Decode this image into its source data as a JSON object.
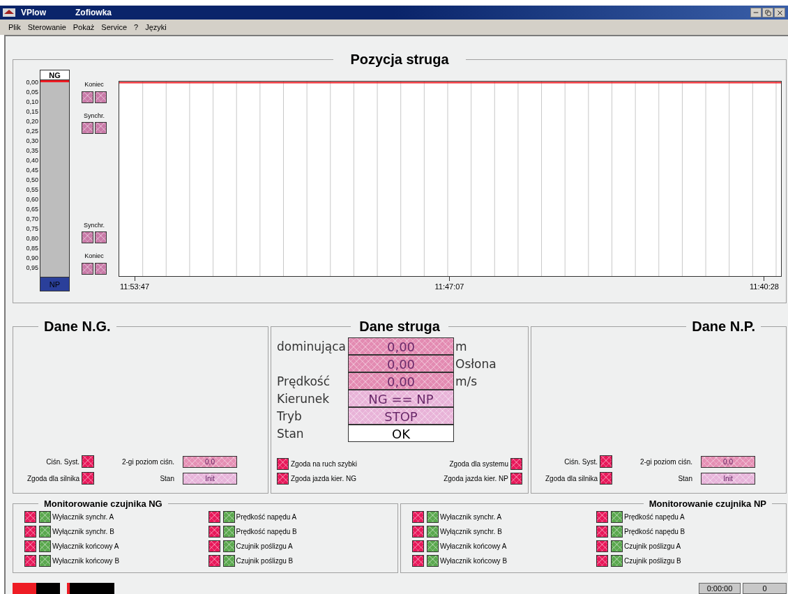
{
  "window": {
    "app": "VPlow",
    "title": "Zofiowka"
  },
  "menu": [
    "Plik",
    "Sterowanie",
    "Pokaż",
    "Service",
    "?",
    "Języki"
  ],
  "position": {
    "title": "Pozycja struga",
    "top_label": "NG",
    "bottom_label": "NP",
    "level": 0,
    "scale": [
      "0,00",
      "0,05",
      "0,10",
      "0,15",
      "0,20",
      "0,25",
      "0,30",
      "0,35",
      "0,40",
      "0,45",
      "0,50",
      "0,55",
      "0,60",
      "0,65",
      "0,70",
      "0,75",
      "0,80",
      "0,85",
      "0,90",
      "0,95"
    ],
    "upper_indicators": [
      {
        "label": "Koniec",
        "lamps": [
          {
            "color": "#c97aa8"
          },
          {
            "color": "#c97aa8"
          }
        ]
      },
      {
        "label": "Synchr.",
        "lamps": [
          {
            "color": "#c97aa8"
          },
          {
            "color": "#c97aa8"
          }
        ]
      }
    ],
    "lower_indicators": [
      {
        "label": "Synchr.",
        "lamps": [
          {
            "color": "#c97aa8"
          },
          {
            "color": "#c97aa8"
          }
        ]
      },
      {
        "label": "Koniec",
        "lamps": [
          {
            "color": "#c97aa8"
          },
          {
            "color": "#c97aa8"
          }
        ]
      }
    ],
    "time_labels": [
      "11:53:47",
      "11:47:07",
      "11:40:28"
    ]
  },
  "ng": {
    "title": "Dane N.G.",
    "lamps": [
      {
        "label": "Ciśn. Syst.",
        "color": "#e8185a"
      },
      {
        "label": "Zgoda dla silnika",
        "color": "#e8185a"
      }
    ],
    "fields": [
      {
        "label": "2-gi poziom ciśn.",
        "value": "0,0",
        "color": "#e58fb4"
      },
      {
        "label": "Stan",
        "value": "Init",
        "color": "#e7b4da"
      }
    ]
  },
  "plow": {
    "title": "Dane struga",
    "rows": [
      {
        "label": "dominująca",
        "value": "0,00",
        "unit": "m",
        "color": "#e38bb2"
      },
      {
        "value": "0,00",
        "unit": "Osłona",
        "color": "#e38bb2"
      },
      {
        "label": "Prędkość",
        "value": "0,00",
        "unit": "m/s",
        "color": "#e38bb2"
      },
      {
        "label": "Kierunek",
        "value": "NG == NP",
        "color": "#e8b3d8"
      },
      {
        "label": "Tryb",
        "value": "STOP",
        "color": "#e8b3d8"
      },
      {
        "label": "Stan",
        "value": "OK",
        "color": "#ffffff"
      }
    ],
    "lamps_left": [
      {
        "label": "Zgoda na ruch szybki",
        "color": "#e8185a"
      },
      {
        "label": "Zgoda jazda kier. NG",
        "color": "#e8185a"
      }
    ],
    "lamps_right": [
      {
        "label": "Zgoda dla systemu",
        "color": "#e8185a"
      },
      {
        "label": "Zgoda jazda kier. NP",
        "color": "#e8185a"
      }
    ]
  },
  "np": {
    "title": "Dane N.P.",
    "lamps": [
      {
        "label": "Ciśn. Syst.",
        "color": "#e8185a"
      },
      {
        "label": "Zgoda dla silnika",
        "color": "#e8185a"
      }
    ],
    "fields": [
      {
        "label": "2-gi poziom ciśn.",
        "value": "0,0",
        "color": "#e58fb4"
      },
      {
        "label": "Stan",
        "value": "Init",
        "color": "#e7b4da"
      }
    ]
  },
  "monitors": [
    {
      "title": "Monitorowanie czujnika NG",
      "columns": [
        [
          {
            "label": "Wyłacznik synchr. A",
            "lamps": [
              {
                "color": "#e8185a"
              },
              {
                "color": "#5aa84e"
              }
            ]
          },
          {
            "label": "Wyłącznik synchr. B",
            "lamps": [
              {
                "color": "#e8185a"
              },
              {
                "color": "#5aa84e"
              }
            ]
          },
          {
            "label": "Wyłacznik końcowy A",
            "lamps": [
              {
                "color": "#e8185a"
              },
              {
                "color": "#5aa84e"
              }
            ]
          },
          {
            "label": "Wyłacznik końcowy B",
            "lamps": [
              {
                "color": "#e8185a"
              },
              {
                "color": "#5aa84e"
              }
            ]
          }
        ],
        [
          {
            "label": "Prędkość napędu A",
            "lamps": [
              {
                "color": "#e8185a"
              },
              {
                "color": "#5aa84e"
              }
            ]
          },
          {
            "label": "Prędkość napędu B",
            "lamps": [
              {
                "color": "#e8185a"
              },
              {
                "color": "#5aa84e"
              }
            ]
          },
          {
            "label": "Czujnik poślizgu A",
            "lamps": [
              {
                "color": "#e8185a"
              },
              {
                "color": "#5aa84e"
              }
            ]
          },
          {
            "label": "Czujnik poślizgu B",
            "lamps": [
              {
                "color": "#e8185a"
              },
              {
                "color": "#5aa84e"
              }
            ]
          }
        ]
      ]
    },
    {
      "title": "Monitorowanie czujnika NP",
      "columns": [
        [
          {
            "label": "Wyłacznik synchr. A",
            "lamps": [
              {
                "color": "#e8185a"
              },
              {
                "color": "#5aa84e"
              }
            ]
          },
          {
            "label": "Wyłącznik synchr. B",
            "lamps": [
              {
                "color": "#e8185a"
              },
              {
                "color": "#5aa84e"
              }
            ]
          },
          {
            "label": "Wyłacznik końcowy A",
            "lamps": [
              {
                "color": "#e8185a"
              },
              {
                "color": "#5aa84e"
              }
            ]
          },
          {
            "label": "Wyłacznik końcowy B",
            "lamps": [
              {
                "color": "#e8185a"
              },
              {
                "color": "#5aa84e"
              }
            ]
          }
        ],
        [
          {
            "label": "Prędkość napędu A",
            "lamps": [
              {
                "color": "#e8185a"
              },
              {
                "color": "#5aa84e"
              }
            ]
          },
          {
            "label": "Prędkość napędu B",
            "lamps": [
              {
                "color": "#e8185a"
              },
              {
                "color": "#5aa84e"
              }
            ]
          },
          {
            "label": "Czujnik poślizgu A",
            "lamps": [
              {
                "color": "#e8185a"
              },
              {
                "color": "#5aa84e"
              }
            ]
          },
          {
            "label": "Czujnik poślizgu B",
            "lamps": [
              {
                "color": "#e8185a"
              },
              {
                "color": "#5aa84e"
              }
            ]
          }
        ]
      ]
    }
  ],
  "status": {
    "meters": [
      {
        "level": 0.5
      },
      {
        "level": 0.06
      }
    ],
    "time": "0:00:00",
    "counter": "0"
  }
}
